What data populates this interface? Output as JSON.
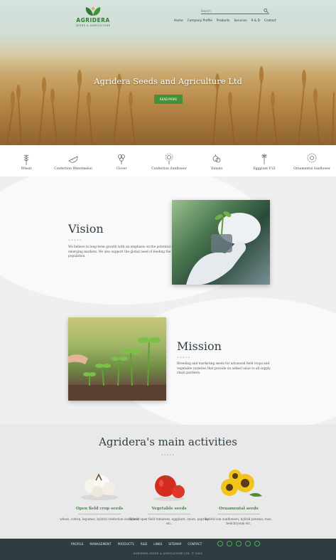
{
  "header": {
    "logo_name": "AGRIDERA",
    "logo_sub": "SEEDS & AGRICULTURE",
    "search_placeholder": "Search",
    "nav": [
      "Home",
      "Company Profile",
      "Products",
      "Services",
      "R & D",
      "Contact"
    ]
  },
  "hero": {
    "title": "Agridera Seeds and Agriculture Ltd",
    "button": "READ MORE"
  },
  "crops": [
    "Wheat",
    "Confection Watermelon",
    "Clover",
    "Confection Sunflower",
    "Tomato",
    "Eggplant F1Z",
    "Ornamental Sunflower"
  ],
  "vision": {
    "title": "Vision",
    "dots": "•••••",
    "text": "We believe in long-term growth with an emphasis on the potential of emerging markets. We also support the global need of feeding the growing population."
  },
  "mission": {
    "title": "Mission",
    "dots": "•••••",
    "text": "Breeding and marketing seeds for advanced field crops and vegetable varieties that provide an added value to all supply chain partners."
  },
  "activities": {
    "title": "Agridera's main activities",
    "dots": "•••••",
    "items": [
      {
        "title": "Open field crop seeds",
        "desc": "wheat, cotton, legumes, hybrid confection sunflower"
      },
      {
        "title": "Vegetable seeds",
        "desc": "hybrid open field tomatoes, eggplant, onion, paprika etc."
      },
      {
        "title": "Ornamental seeds",
        "desc": "hybrid sun sunflowers, hybrid petunia, rose, helichrysum etc."
      }
    ]
  },
  "footer": {
    "nav": [
      "PROFILE",
      "MANAGEMENT",
      "PRODUCTS",
      "R&D",
      "LINKS",
      "SITEMAP",
      "CONTACT"
    ],
    "social": [
      "facebook-icon",
      "twitter-icon",
      "linkedin-icon",
      "youtube-icon",
      "instagram-icon"
    ],
    "copyright": "AGRIDERA SEEDS & AGRICULTURE LTD. © 2024"
  },
  "colors": {
    "brand_green": "#43913a",
    "title_dark": "#2f3e46",
    "footer_bg": "#2f3d42"
  }
}
